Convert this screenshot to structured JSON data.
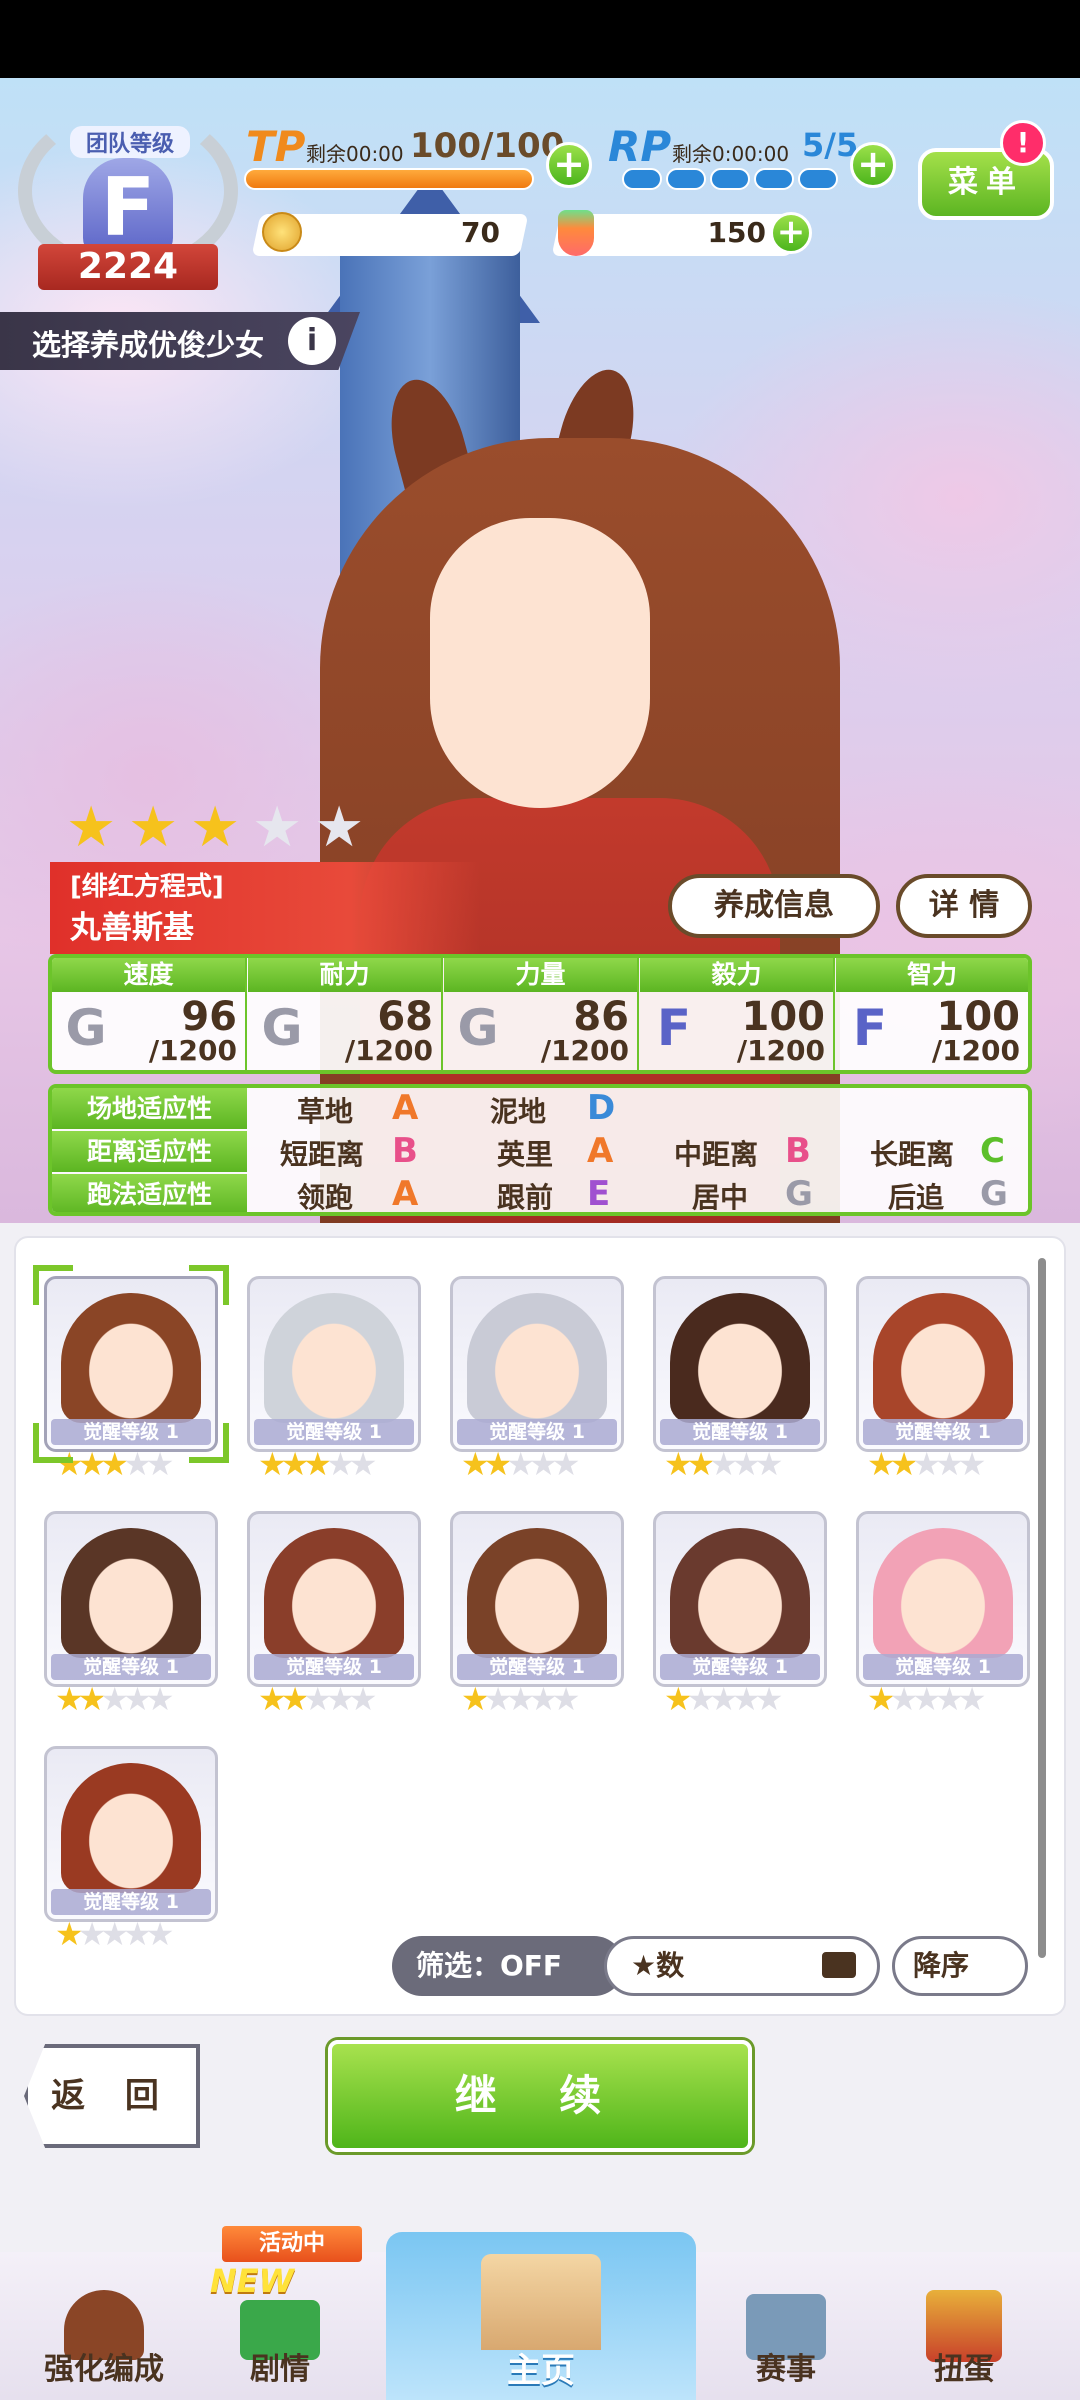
{
  "header": {
    "team_rank_title": "团队等级",
    "team_rank_letter": "F",
    "team_rank_score": "2224",
    "tp_label": "TP",
    "tp_timer": "剩余00:00",
    "tp_value": "100/100",
    "tp_fill": 1.0,
    "rp_label": "RP",
    "rp_timer": "剩余0:00:00",
    "rp_value": "5/5",
    "rp_pips_filled": 5,
    "plus": "+",
    "menu_label": "菜单",
    "menu_badge": "!",
    "coins": "70",
    "carrots": "150"
  },
  "select_title": "选择养成优俊少女",
  "info_icon_text": "i",
  "character": {
    "stars_filled": 3,
    "stars_total": 5,
    "epithet": "[绯红方程式]",
    "name": "丸善斯基",
    "btn_training_info": "养成信息",
    "btn_detail": "详 情"
  },
  "stats": [
    {
      "name": "速度",
      "grade": "G",
      "value": "96",
      "max": "/1200",
      "icon": "shoe-icon"
    },
    {
      "name": "耐力",
      "grade": "G",
      "value": "68",
      "max": "/1200",
      "icon": "heart-icon"
    },
    {
      "name": "力量",
      "grade": "G",
      "value": "86",
      "max": "/1200",
      "icon": "arm-icon"
    },
    {
      "name": "毅力",
      "grade": "F",
      "value": "100",
      "max": "/1200",
      "icon": "flame-icon"
    },
    {
      "name": "智力",
      "grade": "F",
      "value": "100",
      "max": "/1200",
      "icon": "cap-icon"
    }
  ],
  "aptitude": [
    {
      "label": "场地适应性",
      "items": [
        {
          "name": "草地",
          "grade": "A"
        },
        {
          "name": "泥地",
          "grade": "D"
        }
      ]
    },
    {
      "label": "距离适应性",
      "items": [
        {
          "name": "短距离",
          "grade": "B"
        },
        {
          "name": "英里",
          "grade": "A"
        },
        {
          "name": "中距离",
          "grade": "B"
        },
        {
          "name": "长距离",
          "grade": "C"
        }
      ]
    },
    {
      "label": "跑法适应性",
      "items": [
        {
          "name": "领跑",
          "grade": "A"
        },
        {
          "name": "跟前",
          "grade": "E"
        },
        {
          "name": "居中",
          "grade": "G"
        },
        {
          "name": "后追",
          "grade": "G"
        }
      ]
    }
  ],
  "roster": [
    {
      "label": "觉醒等级",
      "level": "1",
      "stars": 3,
      "hair": "#8a4526",
      "selected": true
    },
    {
      "label": "觉醒等级",
      "level": "1",
      "stars": 3,
      "hair": "#cfd3da",
      "selected": false
    },
    {
      "label": "觉醒等级",
      "level": "1",
      "stars": 2,
      "hair": "#c9cbd6",
      "selected": false
    },
    {
      "label": "觉醒等级",
      "level": "1",
      "stars": 2,
      "hair": "#4a2a1e",
      "selected": false
    },
    {
      "label": "觉醒等级",
      "level": "1",
      "stars": 2,
      "hair": "#a8452a",
      "selected": false
    },
    {
      "label": "觉醒等级",
      "level": "1",
      "stars": 2,
      "hair": "#5a3626",
      "selected": false
    },
    {
      "label": "觉醒等级",
      "level": "1",
      "stars": 2,
      "hair": "#8a3e2a",
      "selected": false
    },
    {
      "label": "觉醒等级",
      "level": "1",
      "stars": 1,
      "hair": "#7a4228",
      "selected": false
    },
    {
      "label": "觉醒等级",
      "level": "1",
      "stars": 1,
      "hair": "#6a3a2e",
      "selected": false
    },
    {
      "label": "觉醒等级",
      "level": "1",
      "stars": 1,
      "hair": "#f2a2b6",
      "selected": false
    },
    {
      "label": "觉醒等级",
      "level": "1",
      "stars": 1,
      "hair": "#9a3a22",
      "selected": false
    }
  ],
  "filter_label": "筛选：OFF",
  "sort_label": "★数",
  "order_label": "降序",
  "back_label": "返 回",
  "continue_label": "继 续",
  "nav": {
    "enhance": "强化编成",
    "story": "剧情",
    "story_badge_event": "活动中",
    "story_badge_new": "NEW",
    "home": "主页",
    "race": "赛事",
    "gacha": "扭蛋"
  },
  "colors": {
    "grade_A": "#f0782a",
    "grade_B": "#e8508a",
    "grade_C": "#5cbf2a",
    "grade_D": "#3a8ad8",
    "grade_E": "#a050d0",
    "grade_F": "#5a63c7",
    "grade_G": "#9a9aa8",
    "accent_green": "#5cb522"
  }
}
